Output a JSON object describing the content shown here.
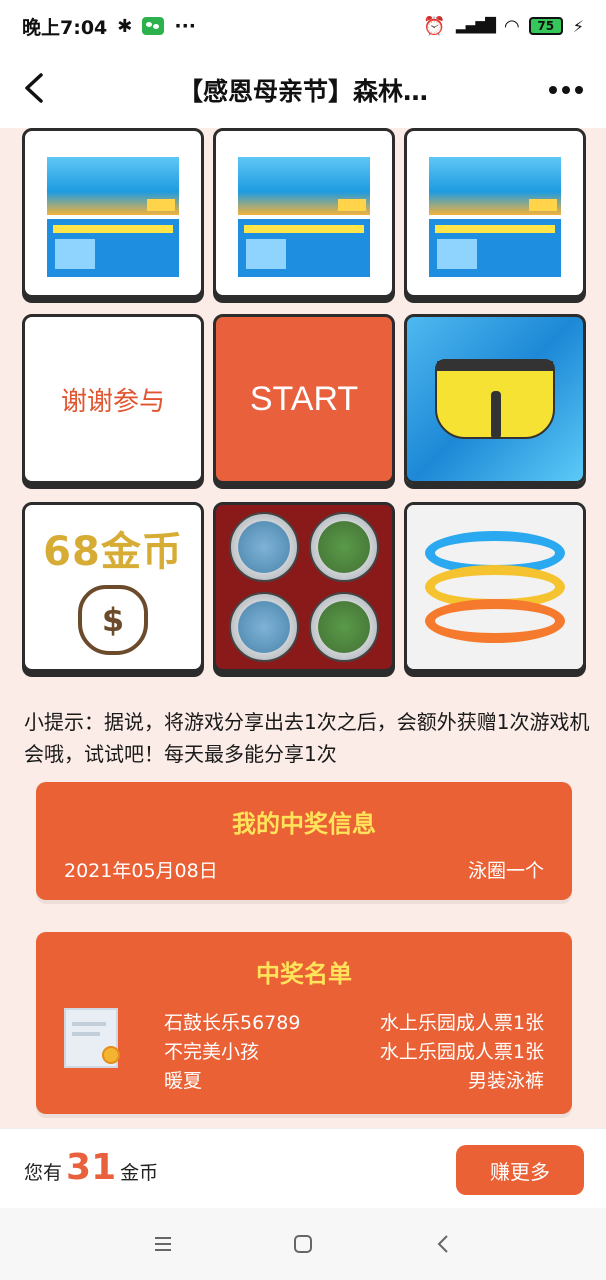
{
  "status": {
    "time": "晚上7:04",
    "more": "···",
    "battery": "75"
  },
  "header": {
    "title": "【感恩母亲节】森林…"
  },
  "grid": {
    "thanks": "谢谢参与",
    "start": "START",
    "coins_prize": "68金币"
  },
  "tip": "小提示：据说，将游戏分享出去1次之后，会额外获赠1次游戏机会哦，试试吧！每天最多能分享1次",
  "my_info": {
    "title": "我的中奖信息",
    "date": "2021年05月08日",
    "prize": "泳圈一个"
  },
  "winners": {
    "title": "中奖名单",
    "rows": [
      {
        "name": "石鼓长乐56789",
        "prize": "水上乐园成人票1张"
      },
      {
        "name": "不完美小孩",
        "prize": "水上乐园成人票1张"
      },
      {
        "name": "暖夏",
        "prize": "男装泳裤"
      }
    ]
  },
  "footer": {
    "prefix": "您有",
    "coins": "31",
    "suffix": "金币",
    "earn_button": "赚更多"
  },
  "colors": {
    "accent": "#ea6136",
    "title_yellow": "#ffe35a",
    "page_bg": "#fbece7"
  }
}
